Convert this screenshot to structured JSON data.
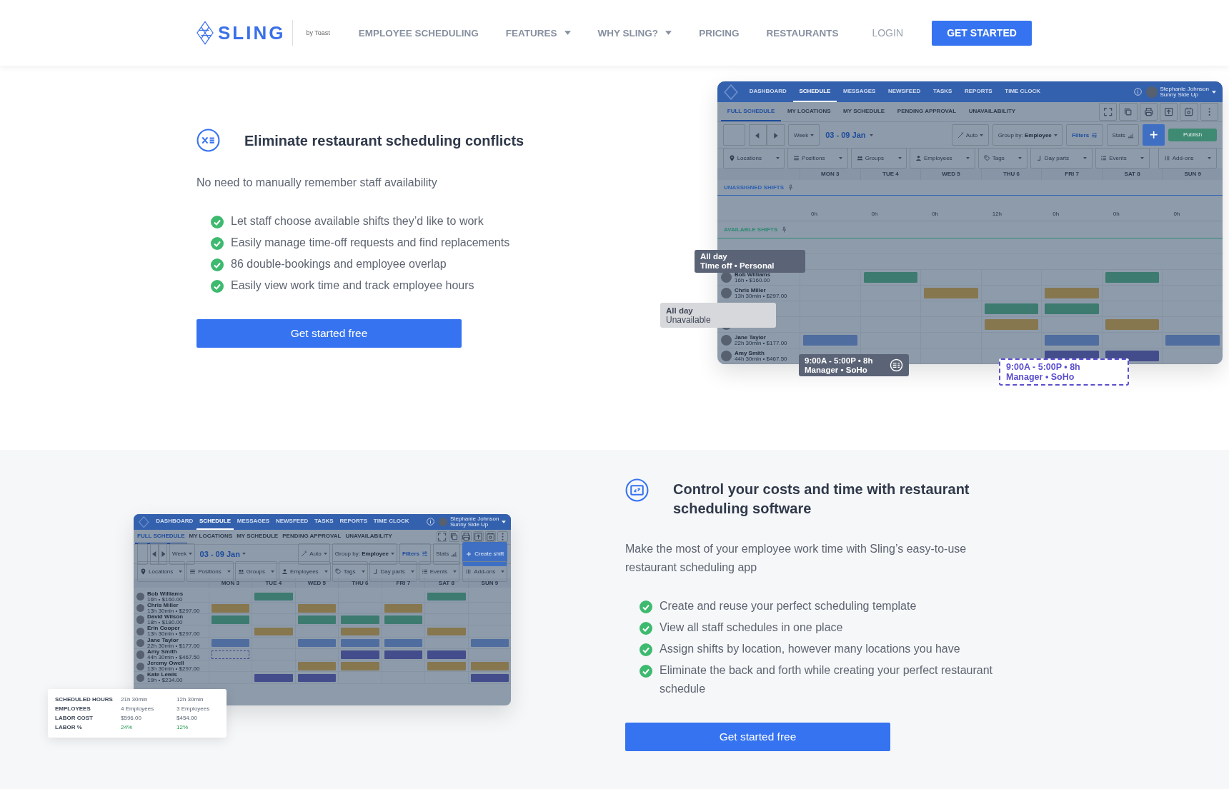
{
  "header": {
    "logo": {
      "name": "SLING",
      "byline": "by Toast"
    },
    "nav": [
      {
        "label": "EMPLOYEE SCHEDULING",
        "dropdown": false
      },
      {
        "label": "FEATURES",
        "dropdown": true
      },
      {
        "label": "WHY SLING?",
        "dropdown": true
      },
      {
        "label": "PRICING",
        "dropdown": false
      },
      {
        "label": "RESTAURANTS",
        "dropdown": false
      }
    ],
    "login": "LOGIN",
    "cta": "GET STARTED"
  },
  "sections": [
    {
      "heading": "Eliminate restaurant scheduling conflicts",
      "intro": "No need to manually remember staff availability",
      "bullets": [
        "Let staff choose available shifts they’d like to work",
        "Easily manage time-off requests and find replacements",
        "86 double-bookings and employee overlap",
        "Easily view work time and track employee hours"
      ],
      "button": "Get started free",
      "mock": {
        "nav": [
          {
            "label": "DASHBOARD",
            "selected": false
          },
          {
            "label": "SCHEDULE",
            "selected": true
          },
          {
            "label": "MESSAGES",
            "selected": false
          },
          {
            "label": "NEWSFEED",
            "selected": false
          },
          {
            "label": "TASKS",
            "selected": false
          },
          {
            "label": "REPORTS",
            "selected": false
          },
          {
            "label": "TIME CLOCK",
            "selected": false
          }
        ],
        "user": {
          "name": "Stephanie Johnson",
          "subtitle": "Sunny Side Up"
        },
        "subtabs": [
          {
            "label": "FULL SCHEDULE",
            "selected": true
          },
          {
            "label": "MY LOCATIONS",
            "selected": false
          },
          {
            "label": "MY SCHEDULE",
            "selected": false
          },
          {
            "label": "PENDING APPROVAL",
            "selected": false
          },
          {
            "label": "UNAVAILABILITY",
            "selected": false
          }
        ],
        "select_all": {
          "checked": false
        },
        "view": "Week",
        "date_range": "03 - 09 Jan",
        "auto": "Auto",
        "group_by_label": "Group by:",
        "group_by": "Employee",
        "filters": "Filters",
        "stats": "Stats",
        "actions": [
          {
            "kind": "plus"
          },
          {
            "kind": "publish",
            "label": "Publish"
          }
        ],
        "filter_chips": [
          "Locations",
          "Positions",
          "Groups",
          "Employees",
          "Tags",
          "Day parts",
          "Events"
        ],
        "add_ons": "Add-ons",
        "days": [
          "MON 3",
          "TUE 4",
          "WED 5",
          "THU 6",
          "FRI 7",
          "SAT 8",
          "SUN 9"
        ],
        "shift_sections": [
          {
            "title": "UNASSIGNED SHIFTS",
            "color": "#2f62b3",
            "hours": [
              "0h",
              "0h",
              "0h",
              "12h",
              "0h",
              "0h",
              "0h"
            ]
          },
          {
            "title": "AVAILABLE SHIFTS",
            "color": "#2e8a72"
          }
        ],
        "employees": [
          {
            "name": "Bob Williams",
            "detail": "16h • $160.00",
            "cells": [
              {
                "kind": "empty"
              },
              {
                "kind": "shift",
                "color": "#3d7b70"
              },
              {
                "kind": "empty"
              },
              {
                "kind": "empty"
              },
              {
                "kind": "empty"
              },
              {
                "kind": "shift",
                "color": "#3d7b70"
              },
              {
                "kind": "empty"
              }
            ]
          },
          {
            "name": "Chris Miller",
            "detail": "13h 30min • $297.00",
            "cells": [
              {
                "kind": "empty"
              },
              {
                "kind": "empty"
              },
              {
                "kind": "shift",
                "color": "#86774f"
              },
              {
                "kind": "empty"
              },
              {
                "kind": "shift",
                "color": "#86774f"
              },
              {
                "kind": "empty"
              },
              {
                "kind": "empty"
              }
            ]
          },
          {
            "cells": [
              {
                "kind": "empty"
              },
              {
                "kind": "empty"
              },
              {
                "kind": "empty"
              },
              {
                "kind": "shift",
                "color": "#3d7b70"
              },
              {
                "kind": "shift",
                "color": "#3d7b70"
              },
              {
                "kind": "empty"
              },
              {
                "kind": "empty"
              }
            ]
          },
          {
            "cells": [
              {
                "kind": "empty"
              },
              {
                "kind": "empty"
              },
              {
                "kind": "empty"
              },
              {
                "kind": "shift",
                "color": "#86774f"
              },
              {
                "kind": "empty"
              },
              {
                "kind": "shift",
                "color": "#86774f"
              },
              {
                "kind": "empty"
              }
            ]
          },
          {
            "name": "Jane Taylor",
            "detail": "22h 30min • $177.00",
            "cells": [
              {
                "kind": "shift",
                "color": "#4f6d9f"
              },
              {
                "kind": "empty"
              },
              {
                "kind": "empty"
              },
              {
                "kind": "empty"
              },
              {
                "kind": "shift",
                "color": "#4f6d9f"
              },
              {
                "kind": "empty"
              },
              {
                "kind": "shift",
                "color": "#4f6d9f"
              }
            ]
          },
          {
            "name": "Amy Smith",
            "detail": "44h 30min • $467.50",
            "cells": [
              {
                "kind": "empty"
              },
              {
                "kind": "empty"
              },
              {
                "kind": "empty"
              },
              {
                "kind": "empty"
              },
              {
                "kind": "shift",
                "color": "#444d8b"
              },
              {
                "kind": "shift",
                "color": "#444d8b"
              },
              {
                "kind": "empty"
              }
            ]
          }
        ]
      },
      "callouts": [
        {
          "kind": "time-off",
          "lines": [
            "All day",
            "Time off • Personal"
          ]
        },
        {
          "kind": "unavailable",
          "lines": [
            "All day",
            "Unavailable"
          ]
        },
        {
          "kind": "shift",
          "lines": [
            "9:00A - 5:00P • 8h",
            "Manager • SoHo"
          ]
        },
        {
          "kind": "drop",
          "lines": [
            "9:00A - 5:00P • 8h",
            "Manager • SoHo"
          ]
        }
      ]
    },
    {
      "heading": "Control your costs and time with restaurant scheduling software",
      "intro": "Make the most of your employee work time with Sling’s easy-to-use restaurant scheduling app",
      "bullets": [
        "Create and reuse your perfect scheduling template",
        "View all staff schedules in one place",
        "Assign shifts by location, however many locations you have",
        "Eliminate the back and forth while creating your perfect restaurant schedule"
      ],
      "button": "Get started free",
      "mock": {
        "nav": [
          {
            "label": "DASHBOARD",
            "selected": false
          },
          {
            "label": "SCHEDULE",
            "selected": true
          },
          {
            "label": "MESSAGES",
            "selected": false
          },
          {
            "label": "NEWSFEED",
            "selected": false
          },
          {
            "label": "TASKS",
            "selected": false
          },
          {
            "label": "REPORTS",
            "selected": false
          },
          {
            "label": "TIME CLOCK",
            "selected": false
          }
        ],
        "user": {
          "name": "Stephanie Johnson",
          "subtitle": "Sunny Side Up"
        },
        "subtabs": [
          {
            "label": "FULL SCHEDULE",
            "selected": true
          },
          {
            "label": "MY LOCATIONS",
            "selected": false
          },
          {
            "label": "MY SCHEDULE",
            "selected": false
          },
          {
            "label": "PENDING APPROVAL",
            "selected": false
          },
          {
            "label": "UNAVAILABILITY",
            "selected": false
          }
        ],
        "select_all": {
          "checked": false
        },
        "view": "Week",
        "date_range": "03 - 09 Jan",
        "auto": "Auto",
        "group_by_label": "Group by:",
        "group_by": "Employee",
        "filters": "Filters",
        "stats": "Stats",
        "actions": [
          {
            "kind": "create",
            "label": "Create shift"
          }
        ],
        "filter_chips": [
          "Locations",
          "Positions",
          "Groups",
          "Employees",
          "Tags",
          "Day parts",
          "Events"
        ],
        "add_ons": "Add-ons",
        "days": [
          "MON 3",
          "TUE 4",
          "WED 5",
          "THU 6",
          "FRI 7",
          "SAT 8",
          "SUN 9"
        ],
        "employees": [
          {
            "name": "Bob Williams",
            "detail": "16h • $160.00",
            "cells": [
              {
                "kind": "empty"
              },
              {
                "kind": "shift",
                "color": "#3d7b70"
              },
              {
                "kind": "empty"
              },
              {
                "kind": "empty"
              },
              {
                "kind": "empty"
              },
              {
                "kind": "shift",
                "color": "#3d7b70"
              },
              {
                "kind": "empty"
              }
            ]
          },
          {
            "name": "Chris Miller",
            "detail": "13h 30min • $297.00",
            "cells": [
              {
                "kind": "shift",
                "color": "#86774f"
              },
              {
                "kind": "empty"
              },
              {
                "kind": "shift",
                "color": "#86774f"
              },
              {
                "kind": "empty"
              },
              {
                "kind": "shift",
                "color": "#86774f"
              },
              {
                "kind": "empty"
              },
              {
                "kind": "empty"
              }
            ]
          },
          {
            "name": "David Wilson",
            "detail": "18h • $180.00",
            "cells": [
              {
                "kind": "shift",
                "color": "#3d7b70"
              },
              {
                "kind": "empty"
              },
              {
                "kind": "shift",
                "color": "#3d7b70"
              },
              {
                "kind": "shift",
                "color": "#3d7b70"
              },
              {
                "kind": "shift",
                "color": "#3d7b70"
              },
              {
                "kind": "empty"
              },
              {
                "kind": "empty"
              }
            ]
          },
          {
            "name": "Erin Cooper",
            "detail": "13h 30min • $297.00",
            "cells": [
              {
                "kind": "empty"
              },
              {
                "kind": "shift",
                "color": "#86774f"
              },
              {
                "kind": "empty"
              },
              {
                "kind": "shift",
                "color": "#86774f"
              },
              {
                "kind": "empty"
              },
              {
                "kind": "shift",
                "color": "#86774f"
              },
              {
                "kind": "empty"
              }
            ]
          },
          {
            "name": "Jane Taylor",
            "detail": "22h 30min • $177.00",
            "cells": [
              {
                "kind": "shift",
                "color": "#4f6d9f"
              },
              {
                "kind": "empty"
              },
              {
                "kind": "shift",
                "color": "#4f6d9f"
              },
              {
                "kind": "shift",
                "color": "#4f6d9f"
              },
              {
                "kind": "shift",
                "color": "#4f6d9f"
              },
              {
                "kind": "empty"
              },
              {
                "kind": "shift",
                "color": "#4f6d9f"
              }
            ]
          },
          {
            "name": "Amy Smith",
            "detail": "44h 30min • $467.50",
            "cells": [
              {
                "kind": "open"
              },
              {
                "kind": "empty"
              },
              {
                "kind": "empty"
              },
              {
                "kind": "shift",
                "color": "#444d8b"
              },
              {
                "kind": "shift",
                "color": "#444d8b"
              },
              {
                "kind": "shift",
                "color": "#444d8b"
              },
              {
                "kind": "empty"
              }
            ]
          },
          {
            "name": "Jeremy Owell",
            "detail": "13h 30min • $297.00",
            "cells": [
              {
                "kind": "empty"
              },
              {
                "kind": "empty"
              },
              {
                "kind": "shift",
                "color": "#86774f"
              },
              {
                "kind": "shift",
                "color": "#86774f"
              },
              {
                "kind": "empty"
              },
              {
                "kind": "shift",
                "color": "#86774f"
              },
              {
                "kind": "shift",
                "color": "#86774f"
              }
            ]
          },
          {
            "name": "Kate Lewis",
            "detail": "19h • $234.00",
            "cells": [
              {
                "kind": "empty"
              },
              {
                "kind": "shift",
                "color": "#444d8b"
              },
              {
                "kind": "shift",
                "color": "#444d8b"
              },
              {
                "kind": "empty"
              },
              {
                "kind": "empty"
              },
              {
                "kind": "empty"
              },
              {
                "kind": "shift",
                "color": "#444d8b"
              }
            ]
          }
        ]
      },
      "stats": [
        {
          "kind": "plain",
          "label": "SCHEDULED HOURS",
          "values": [
            "21h 30min",
            "12h 30min"
          ]
        },
        {
          "kind": "plain",
          "label": "EMPLOYEES",
          "values": [
            "4 Employees",
            "3 Employees"
          ]
        },
        {
          "kind": "plain",
          "label": "LABOR COST",
          "values": [
            "$596.00",
            "$454.00"
          ]
        },
        {
          "kind": "percent",
          "label": "LABOR %",
          "values": [
            "24%",
            "12%"
          ]
        }
      ]
    }
  ]
}
